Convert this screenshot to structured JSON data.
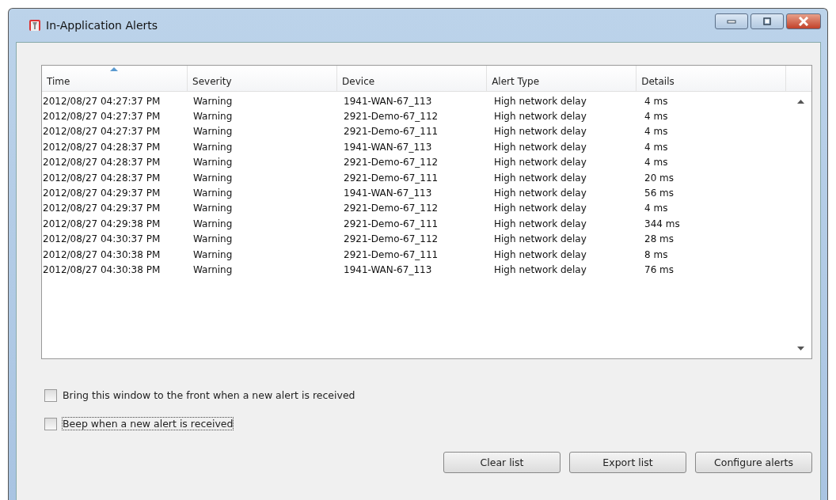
{
  "window": {
    "title": "In-Application Alerts"
  },
  "table": {
    "columns": [
      {
        "label": "Time",
        "sorted": true
      },
      {
        "label": "Severity",
        "sorted": false
      },
      {
        "label": "Device",
        "sorted": false
      },
      {
        "label": "Alert Type",
        "sorted": false
      },
      {
        "label": "Details",
        "sorted": false
      }
    ],
    "rows": [
      [
        "2012/08/27 04:27:37 PM",
        "Warning",
        "1941-WAN-67_113",
        "High network delay",
        "4 ms"
      ],
      [
        "2012/08/27 04:27:37 PM",
        "Warning",
        "2921-Demo-67_112",
        "High network delay",
        "4 ms"
      ],
      [
        "2012/08/27 04:27:37 PM",
        "Warning",
        "2921-Demo-67_111",
        "High network delay",
        "4 ms"
      ],
      [
        "2012/08/27 04:28:37 PM",
        "Warning",
        "1941-WAN-67_113",
        "High network delay",
        "4 ms"
      ],
      [
        "2012/08/27 04:28:37 PM",
        "Warning",
        "2921-Demo-67_112",
        "High network delay",
        "4 ms"
      ],
      [
        "2012/08/27 04:28:37 PM",
        "Warning",
        "2921-Demo-67_111",
        "High network delay",
        "20 ms"
      ],
      [
        "2012/08/27 04:29:37 PM",
        "Warning",
        "1941-WAN-67_113",
        "High network delay",
        "56 ms"
      ],
      [
        "2012/08/27 04:29:37 PM",
        "Warning",
        "2921-Demo-67_112",
        "High network delay",
        "4 ms"
      ],
      [
        "2012/08/27 04:29:38 PM",
        "Warning",
        "2921-Demo-67_111",
        "High network delay",
        "344 ms"
      ],
      [
        "2012/08/27 04:30:37 PM",
        "Warning",
        "2921-Demo-67_112",
        "High network delay",
        "28 ms"
      ],
      [
        "2012/08/27 04:30:38 PM",
        "Warning",
        "2921-Demo-67_111",
        "High network delay",
        "8 ms"
      ],
      [
        "2012/08/27 04:30:38 PM",
        "Warning",
        "1941-WAN-67_113",
        "High network delay",
        "76 ms"
      ]
    ]
  },
  "options": [
    {
      "label": "Bring this window to the front when a new alert is received",
      "checked": false,
      "focused": false
    },
    {
      "label": "Beep when a new alert is received",
      "checked": false,
      "focused": true
    }
  ],
  "buttons": [
    "Clear list",
    "Export list",
    "Configure alerts"
  ]
}
